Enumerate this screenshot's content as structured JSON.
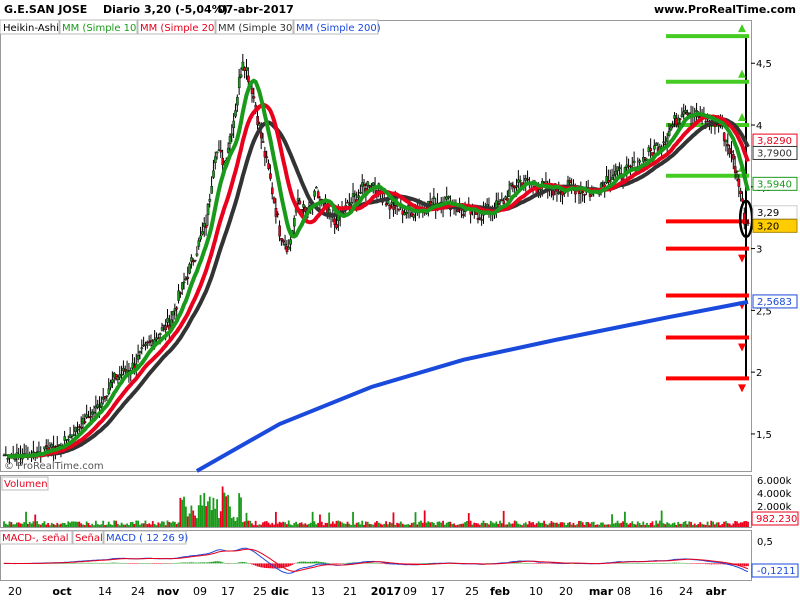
{
  "header": {
    "symbol": "G.E.SAN JOSE",
    "period": "Diario",
    "quote": "3,20 (-5,04%)",
    "date": "07-abr-2017",
    "site": "www.ProRealTime.com",
    "watermark": "© ProRealTime.com"
  },
  "legend": [
    {
      "label": "Heikin-Ashi",
      "color": "#000000"
    },
    {
      "label": "MM (Simple 10)",
      "color": "#1a9a1a"
    },
    {
      "label": "MM (Simple 20)",
      "color": "#e8001c"
    },
    {
      "label": "MM (Simple 30)",
      "color": "#333333"
    },
    {
      "label": "MM (Simple 200)",
      "color": "#1a4adc"
    }
  ],
  "colors": {
    "up": "#1a9a1a",
    "down": "#e8001c",
    "ma10": "#1a9a1a",
    "ma20": "#e8001c",
    "ma30": "#333333",
    "ma200": "#1a4adc",
    "level_green": "#44cc22",
    "level_red": "#ff0000",
    "current_bg": "#ffcc00"
  },
  "volume_panel": {
    "title": "Volumen",
    "ticks": [
      "6.000k",
      "4.000k",
      "2.000k"
    ],
    "last_value": "982.230"
  },
  "macd_panel": {
    "legend": [
      "MACD-, señal",
      "Señal",
      "MACD ( 12 26 9)"
    ],
    "ticks": [
      "0,5"
    ],
    "last_value": "-0,1211"
  },
  "price_labels": {
    "ma20": "3,8290",
    "ma30": "3,7900",
    "ma10": "3,5940",
    "prev": "3,29",
    "close": "3,20",
    "ma200": "2,5683"
  },
  "chart_data": {
    "type": "candlestick",
    "title": "G.E.SAN JOSE Diario 3,20 (-5,04%) 07-abr-2017",
    "y_ticks": [
      "4,5",
      "4",
      "3,5",
      "3",
      "2,5",
      "2",
      "1,5"
    ],
    "ylim": [
      1.2,
      4.85
    ],
    "x_ticks": [
      "20",
      "oct",
      "14",
      "24",
      "nov",
      "09",
      "17",
      "25",
      "dic",
      "13",
      "21",
      "2017",
      "09",
      "17",
      "25",
      "feb",
      "10",
      "20",
      "mar",
      "08",
      "16",
      "24",
      "abr"
    ],
    "anchors": [
      [
        0,
        1.33
      ],
      [
        10,
        1.32
      ],
      [
        20,
        1.36
      ],
      [
        30,
        1.4
      ],
      [
        40,
        1.55
      ],
      [
        50,
        1.7
      ],
      [
        60,
        1.95
      ],
      [
        70,
        2.05
      ],
      [
        80,
        2.25
      ],
      [
        90,
        2.4
      ],
      [
        100,
        2.8
      ],
      [
        110,
        3.2
      ],
      [
        115,
        3.8
      ],
      [
        120,
        3.7
      ],
      [
        125,
        4.05
      ],
      [
        130,
        4.55
      ],
      [
        135,
        4.3
      ],
      [
        140,
        3.9
      ],
      [
        145,
        3.55
      ],
      [
        150,
        3.15
      ],
      [
        155,
        3.0
      ],
      [
        160,
        3.4
      ],
      [
        165,
        3.25
      ],
      [
        170,
        3.45
      ],
      [
        175,
        3.3
      ],
      [
        180,
        3.2
      ],
      [
        190,
        3.4
      ],
      [
        200,
        3.55
      ],
      [
        210,
        3.35
      ],
      [
        220,
        3.3
      ],
      [
        230,
        3.35
      ],
      [
        240,
        3.4
      ],
      [
        250,
        3.3
      ],
      [
        260,
        3.28
      ],
      [
        270,
        3.35
      ],
      [
        280,
        3.55
      ],
      [
        290,
        3.5
      ],
      [
        300,
        3.48
      ],
      [
        310,
        3.5
      ],
      [
        320,
        3.45
      ],
      [
        330,
        3.6
      ],
      [
        340,
        3.62
      ],
      [
        350,
        3.75
      ],
      [
        360,
        3.9
      ],
      [
        370,
        4.15
      ],
      [
        380,
        4.05
      ],
      [
        390,
        4.0
      ],
      [
        395,
        3.8
      ],
      [
        400,
        3.55
      ],
      [
        403,
        3.25
      ],
      [
        405,
        3.2
      ]
    ],
    "ma200_anchors": [
      [
        105,
        1.2
      ],
      [
        150,
        1.58
      ],
      [
        200,
        1.88
      ],
      [
        250,
        2.1
      ],
      [
        300,
        2.26
      ],
      [
        360,
        2.44
      ],
      [
        405,
        2.5683
      ]
    ],
    "levels": [
      {
        "value": 4.72,
        "color": "green"
      },
      {
        "value": 4.35,
        "color": "green"
      },
      {
        "value": 4.0,
        "color": "green"
      },
      {
        "value": 3.59,
        "color": "green"
      },
      {
        "value": 3.22,
        "color": "red"
      },
      {
        "value": 3.0,
        "color": "red"
      },
      {
        "value": 2.62,
        "color": "red"
      },
      {
        "value": 2.28,
        "color": "red"
      },
      {
        "value": 1.95,
        "color": "red"
      }
    ],
    "last": {
      "close": 3.2,
      "change_pct": -5.04,
      "ma10": 3.594,
      "ma20": 3.829,
      "ma30": 3.79,
      "ma200": 2.5683
    },
    "volume_ylim": [
      0,
      7000
    ],
    "macd_ylim": [
      -0.3,
      0.7
    ],
    "grid": false
  }
}
